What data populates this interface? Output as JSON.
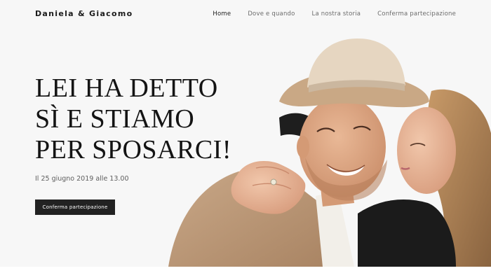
{
  "header": {
    "brand": "Daniela & Giacomo",
    "nav": [
      {
        "label": "Home",
        "active": true
      },
      {
        "label": "Dove e quando",
        "active": false
      },
      {
        "label": "La nostra storia",
        "active": false
      },
      {
        "label": "Conferma partecipazione",
        "active": false
      }
    ]
  },
  "hero": {
    "headline_lines": [
      "LEI HA DETTO",
      "SÌ E STIAMO",
      "PER SPOSARCI!"
    ],
    "date_line": "Il 25 giugno 2019 alle 13.00",
    "cta_label": "Conferma partecipazione",
    "photo": {
      "subject": "couple-embracing-photo"
    }
  },
  "colors": {
    "background": "#f7f7f7",
    "text": "#1b1b1b",
    "button": "#222222",
    "nav_inactive": "#6b6b6b"
  }
}
